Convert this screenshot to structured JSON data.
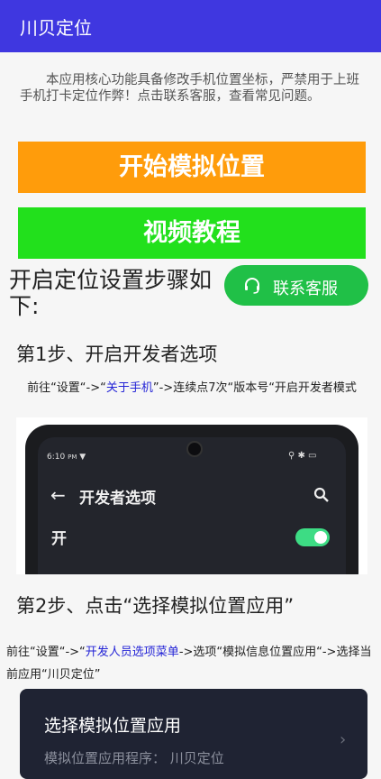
{
  "appbar": {
    "title": "川贝定位"
  },
  "intro": "本应用核心功能具备修改手机位置坐标，严禁用于上班手机打卡定位作弊！点击联系客服，查看常见问题。",
  "buttons": {
    "start": "开始模拟位置",
    "video": "视频教程",
    "contact": "联系客服"
  },
  "section_heading": "开启定位设置步骤如下:",
  "steps": [
    {
      "title": "第1步、开启开发者选项",
      "desc_prefix": "前往“设置“->“",
      "desc_link": "关于手机",
      "desc_suffix": "”->连续点7次“版本号“开启开发者模式"
    },
    {
      "title": "第2步、点击“选择模拟位置应用”",
      "desc_prefix": "前往“设置“->“",
      "desc_link": "开发人员选项菜单",
      "desc_suffix": "->选项“模拟信息位置应用“->选择当前应用“川贝定位”"
    }
  ],
  "phone": {
    "time": "6:10",
    "ampm": "PM",
    "title": "开发者选项",
    "toggle_label": "开",
    "toggle_on": true
  },
  "card": {
    "title": "选择模拟位置应用",
    "subtitle": "模拟位置应用程序：  川贝定位"
  },
  "colors": {
    "appbar": "#3f37e0",
    "start_button": "#ff9c0b",
    "video_button": "#22e01c",
    "contact_button": "#20c047",
    "link": "#2424d6"
  }
}
